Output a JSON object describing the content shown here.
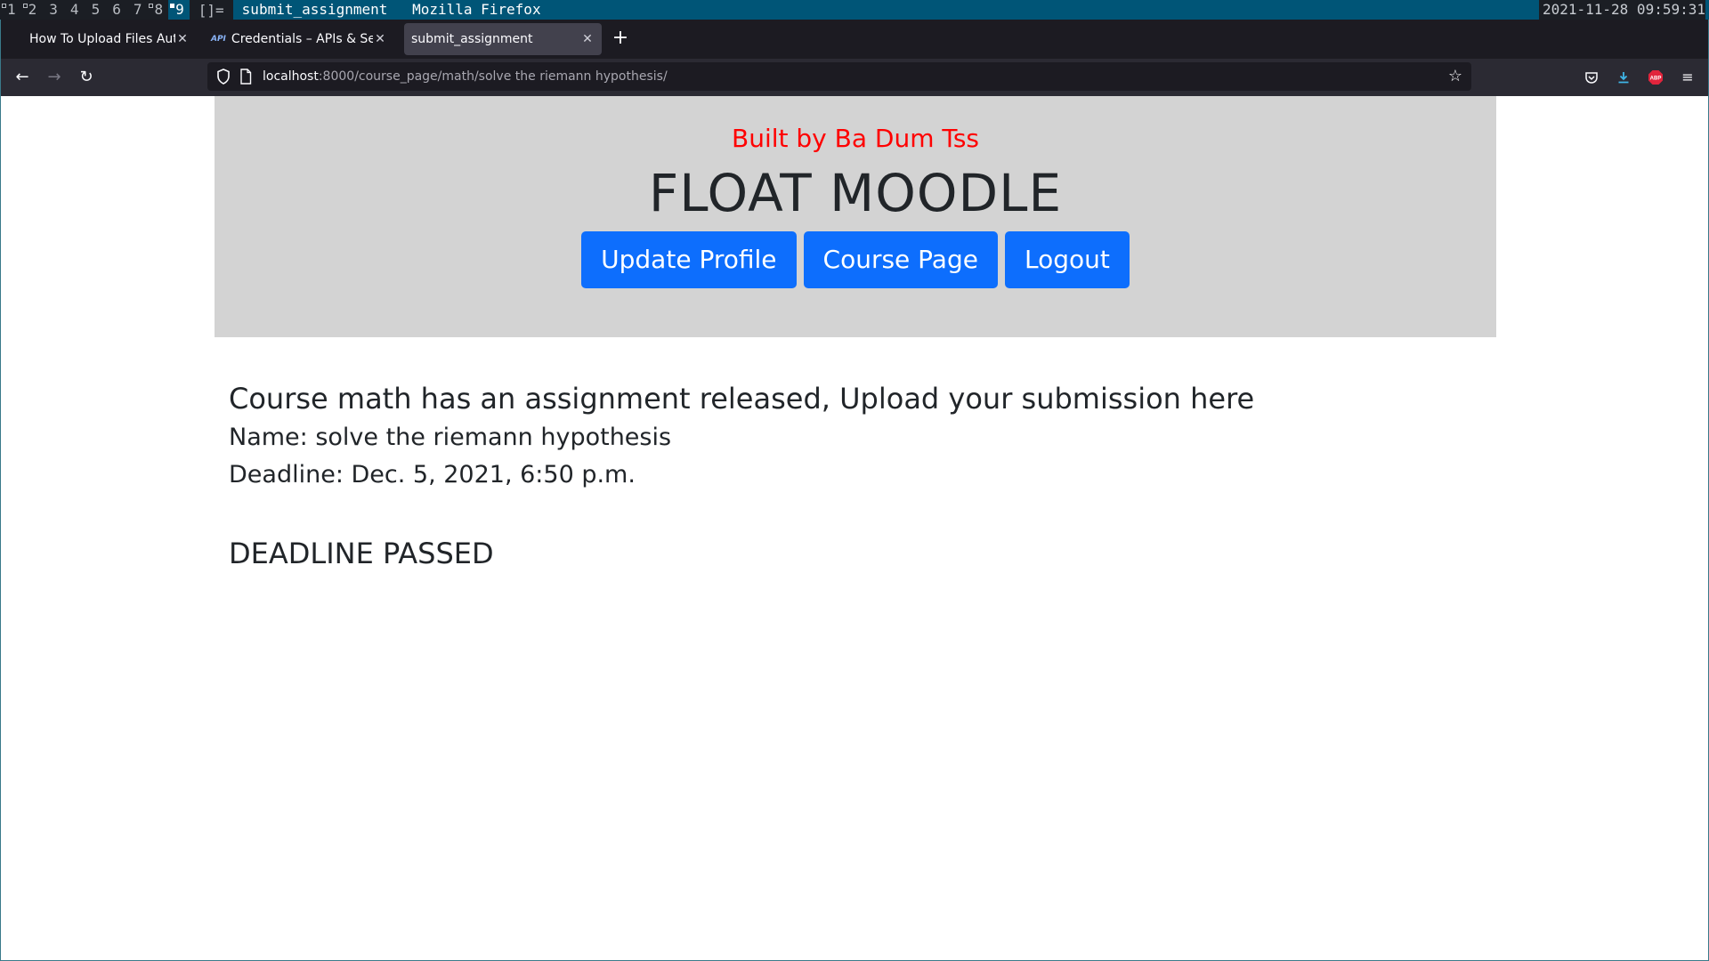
{
  "wm": {
    "workspaces": [
      {
        "label": "1",
        "occupied": true
      },
      {
        "label": "2",
        "occupied": true
      },
      {
        "label": "3",
        "occupied": false
      },
      {
        "label": "4",
        "occupied": false
      },
      {
        "label": "5",
        "occupied": false
      },
      {
        "label": "6",
        "occupied": false
      },
      {
        "label": "7",
        "occupied": false
      },
      {
        "label": "8",
        "occupied": true
      },
      {
        "label": "9",
        "occupied": true,
        "active": true
      }
    ],
    "layout": "[]=",
    "window_title": "submit_assignment",
    "app_name": "Mozilla Firefox",
    "clock": "2021-11-28 09:59:31"
  },
  "browser": {
    "tabs": [
      {
        "title": "How To Upload Files Auto",
        "icon": "none"
      },
      {
        "title": "Credentials – APIs & Serv",
        "icon": "api-badge-icon",
        "badge": "API"
      },
      {
        "title": "submit_assignment",
        "icon": "none",
        "selected": true
      }
    ],
    "url_host": "localhost",
    "url_path": ":8000/course_page/math/solve the riemann hypothesis/"
  },
  "page": {
    "built_by": "Built by Ba Dum Tss",
    "site_title": "FLOAT MOODLE",
    "buttons": {
      "update_profile": "Update Profile",
      "course_page": "Course Page",
      "logout": "Logout"
    },
    "assignment_heading": "Course math has an assignment released, Upload your submission here",
    "name_line": "Name: solve the riemann hypothesis",
    "deadline_line": "Deadline: Dec. 5, 2021, 6:50 p.m.",
    "deadline_status": "DEADLINE PASSED"
  },
  "colors": {
    "header_bg": "#d3d3d3",
    "built_by": "#ff0000",
    "button": "#0d6efd",
    "wm_accent": "#005577"
  }
}
